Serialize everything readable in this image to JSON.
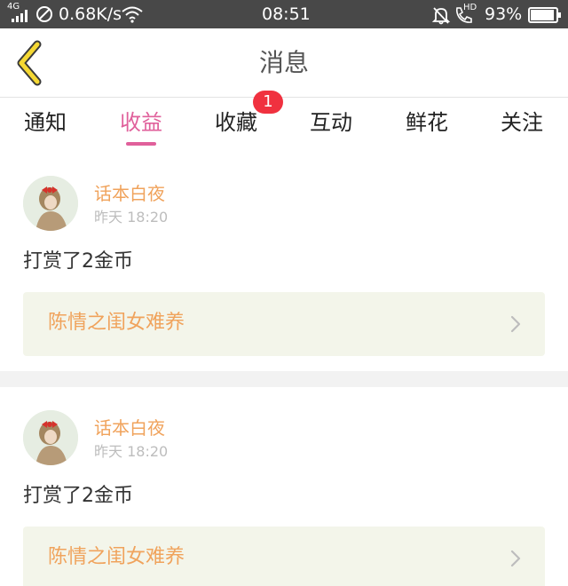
{
  "status_bar": {
    "network_type": "4G",
    "speed": "0.68K/s",
    "hd_label": "HD",
    "battery": "93%",
    "battery_level": 0.93,
    "time": "08:51"
  },
  "header": {
    "title": "消息",
    "back_icon": "chevron-left-icon",
    "accent_color": "#f5d833"
  },
  "tabs": {
    "items": [
      {
        "label": "通知",
        "active": false
      },
      {
        "label": "收益",
        "active": true
      },
      {
        "label": "收藏",
        "active": false
      },
      {
        "label": "互动",
        "active": false
      },
      {
        "label": "鲜花",
        "active": false
      },
      {
        "label": "关注",
        "active": false
      }
    ],
    "badge": "1",
    "active_color": "#e0609b",
    "badge_color": "#f0313f"
  },
  "messages": [
    {
      "sender": "话本白夜",
      "time": "昨天 18:20",
      "text": "打赏了2金币",
      "book_title": "陈情之闺女难养"
    },
    {
      "sender": "话本白夜",
      "time": "昨天 18:20",
      "text": "打赏了2金币",
      "book_title": "陈情之闺女难养"
    }
  ],
  "colors": {
    "sender": "#f0a35c",
    "book_bg": "#f3f5ea",
    "status_bar_bg": "#484848"
  }
}
